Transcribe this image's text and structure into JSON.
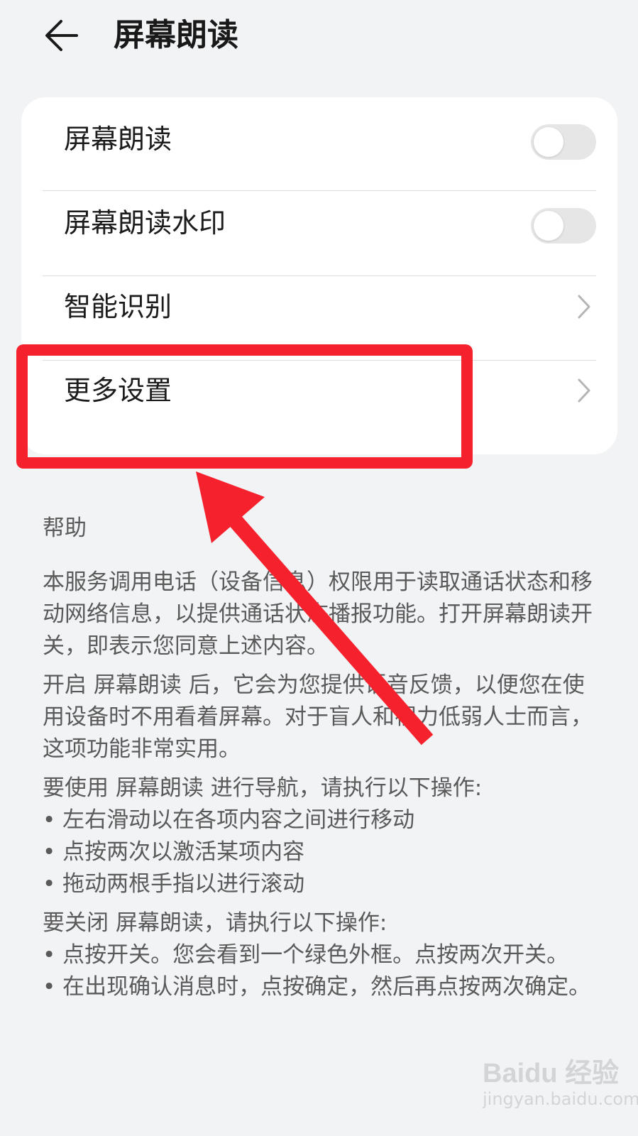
{
  "header": {
    "title": "屏幕朗读"
  },
  "settings": {
    "items": [
      {
        "label": "屏幕朗读",
        "control": "toggle",
        "on": false
      },
      {
        "label": "屏幕朗读水印",
        "control": "toggle",
        "on": false
      },
      {
        "label": "智能识别",
        "control": "chevron"
      },
      {
        "label": "更多设置",
        "control": "chevron"
      }
    ]
  },
  "help": {
    "title": "帮助",
    "paragraphs": [
      "本服务调用电话（设备信息）权限用于读取通话状态和移动网络信息，以提供通话状态播报功能。打开屏幕朗读开关，即表示您同意上述内容。",
      "开启 屏幕朗读 后，它会为您提供语音反馈，以便您在使用设备时不用看着屏幕。对于盲人和视力低弱人士而言，这项功能非常实用。",
      "要使用 屏幕朗读 进行导航，请执行以下操作:"
    ],
    "nav_bullets": [
      "•  左右滑动以在各项内容之间进行移动",
      "•  点按两次以激活某项内容",
      "•  拖动两根手指以进行滚动"
    ],
    "close_intro": "要关闭 屏幕朗读，请执行以下操作:",
    "close_bullets": [
      "•  点按开关。您会看到一个绿色外框。点按两次开关。",
      "•  在出现确认消息时，点按确定，然后再点按两次确定。"
    ]
  },
  "annotation": {
    "color": "#f5222d"
  },
  "watermark": {
    "logo": "Baidu 经验",
    "sub": "jingyan.baidu.com"
  }
}
